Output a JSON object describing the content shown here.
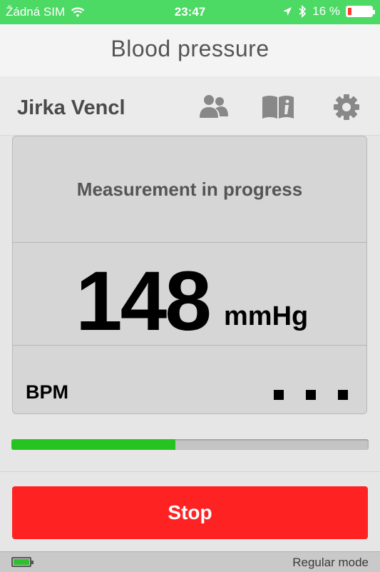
{
  "status_bar": {
    "carrier": "Žádná SIM",
    "time": "23:47",
    "battery_percent": "16 %",
    "battery_level": 0.16,
    "icons": [
      "wifi-icon",
      "location-arrow-icon",
      "bluetooth-icon",
      "battery-icon"
    ]
  },
  "header": {
    "title": "Blood pressure"
  },
  "user": {
    "name": "Jirka Vencl",
    "icons": [
      "users-icon",
      "guide-book-icon",
      "settings-gear-icon"
    ]
  },
  "measurement": {
    "status": "Measurement in progress",
    "value": "148",
    "unit": "mmHg",
    "bpm_label": "BPM"
  },
  "progress": {
    "fraction": 0.46,
    "color": "#26c421"
  },
  "stop_button": {
    "label": "Stop",
    "color": "#ff2222"
  },
  "footer": {
    "mode": "Regular mode",
    "device_battery_icon": "battery-full-icon"
  },
  "colors": {
    "status_bar": "#4cd964",
    "accent_green": "#26c421"
  }
}
